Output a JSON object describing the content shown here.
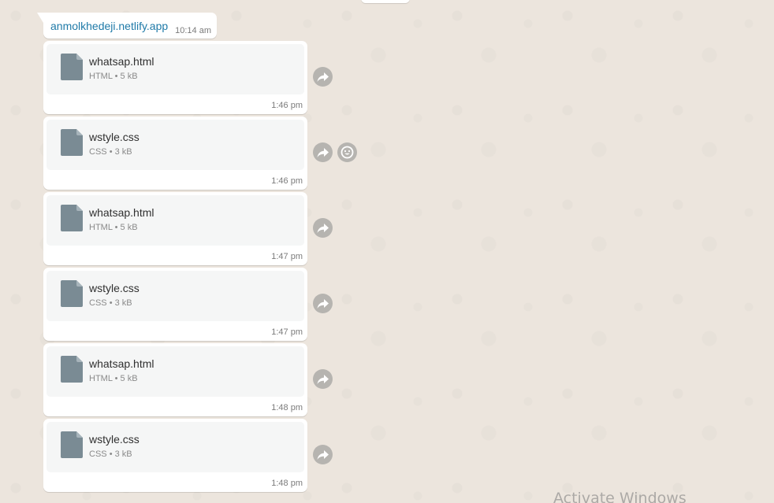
{
  "link_message": {
    "text": "anmolkhedeji.netlify.app",
    "time": "10:14 am"
  },
  "documents": [
    {
      "name": "whatsap.html",
      "type": "HTML",
      "size": "5 kB",
      "time": "1:46 pm",
      "icon": "document-icon"
    },
    {
      "name": "wstyle.css",
      "type": "CSS",
      "size": "3 kB",
      "time": "1:46 pm",
      "icon": "document-icon"
    },
    {
      "name": "whatsap.html",
      "type": "HTML",
      "size": "5 kB",
      "time": "1:47 pm",
      "icon": "document-icon"
    },
    {
      "name": "wstyle.css",
      "type": "CSS",
      "size": "3 kB",
      "time": "1:47 pm",
      "icon": "document-icon"
    },
    {
      "name": "whatsap.html",
      "type": "HTML",
      "size": "5 kB",
      "time": "1:48 pm",
      "icon": "document-icon"
    },
    {
      "name": "wstyle.css",
      "type": "CSS",
      "size": "3 kB",
      "time": "1:48 pm",
      "icon": "document-icon"
    }
  ],
  "meta_separator": "•",
  "watermark": "Activate Windows",
  "colors": {
    "chat_background": "#ece5dd",
    "bubble": "#ffffff",
    "doc_card": "#f5f6f6",
    "doc_icon": "#7a8b94",
    "link": "#1f7aa8",
    "action_button": "#b6b4b0"
  }
}
